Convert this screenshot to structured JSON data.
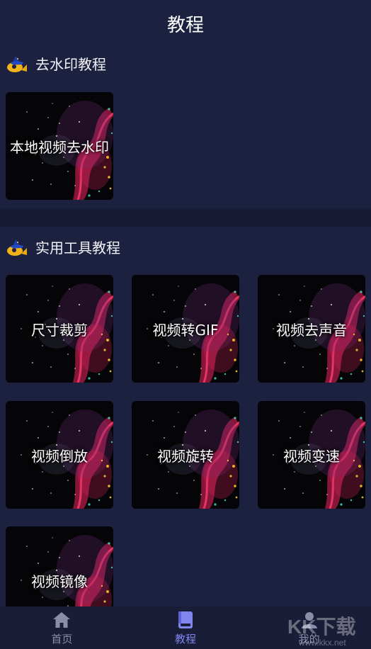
{
  "header": {
    "title": "教程"
  },
  "sections": [
    {
      "title": "去水印教程",
      "items": [
        {
          "label": "本地视频去水印"
        }
      ]
    },
    {
      "title": "实用工具教程",
      "items": [
        {
          "label": "尺寸裁剪"
        },
        {
          "label": "视频转GIF"
        },
        {
          "label": "视频去声音"
        },
        {
          "label": "视频倒放"
        },
        {
          "label": "视频旋转"
        },
        {
          "label": "视频变速"
        },
        {
          "label": "视频镜像"
        }
      ]
    }
  ],
  "bottom_nav": [
    {
      "label": "首页",
      "icon": "home-icon",
      "active": false
    },
    {
      "label": "教程",
      "icon": "book-icon",
      "active": true
    },
    {
      "label": "我的",
      "icon": "user-icon",
      "active": false
    }
  ],
  "colors": {
    "background": "#1d2140",
    "divider": "#181b35",
    "nav_active": "#7e86ee",
    "nav_inactive": "#8a8ca8"
  }
}
